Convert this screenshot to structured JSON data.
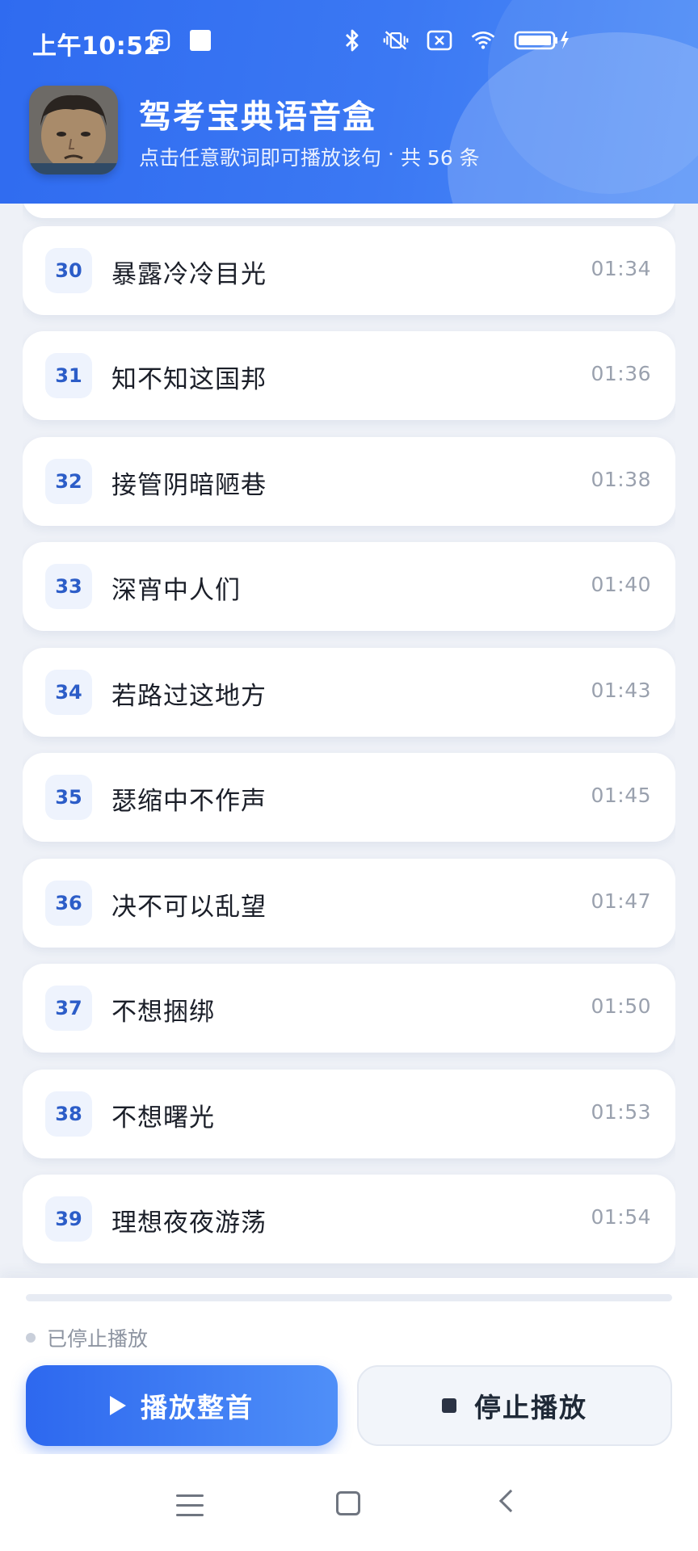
{
  "statusbar": {
    "time": "上午10:52",
    "icons": [
      "s-badge-icon",
      "square-notification-icon",
      "bluetooth-icon",
      "vibrate-off-icon",
      "sim-x-icon",
      "wifi-icon",
      "battery-charging-icon"
    ]
  },
  "header": {
    "title": "驾考宝典语音盒",
    "subtitle": "点击任意歌词即可播放该句",
    "separator": "·",
    "count": "共 56 条",
    "accent": "#2f6bf0"
  },
  "lyrics": [
    {
      "num": "30",
      "text": "暴露冷冷目光",
      "time": "01:34"
    },
    {
      "num": "31",
      "text": "知不知这国邦",
      "time": "01:36"
    },
    {
      "num": "32",
      "text": "接管阴暗陋巷",
      "time": "01:38"
    },
    {
      "num": "33",
      "text": "深宵中人们",
      "time": "01:40"
    },
    {
      "num": "34",
      "text": "若路过这地方",
      "time": "01:43"
    },
    {
      "num": "35",
      "text": "瑟缩中不作声",
      "time": "01:45"
    },
    {
      "num": "36",
      "text": "决不可以乱望",
      "time": "01:47"
    },
    {
      "num": "37",
      "text": "不想捆绑",
      "time": "01:50"
    },
    {
      "num": "38",
      "text": "不想曙光",
      "time": "01:53"
    },
    {
      "num": "39",
      "text": "理想夜夜游荡",
      "time": "01:54"
    }
  ],
  "player": {
    "progress": 0,
    "status": "已停止播放",
    "play_label": "播放整首",
    "stop_label": "停止播放"
  }
}
